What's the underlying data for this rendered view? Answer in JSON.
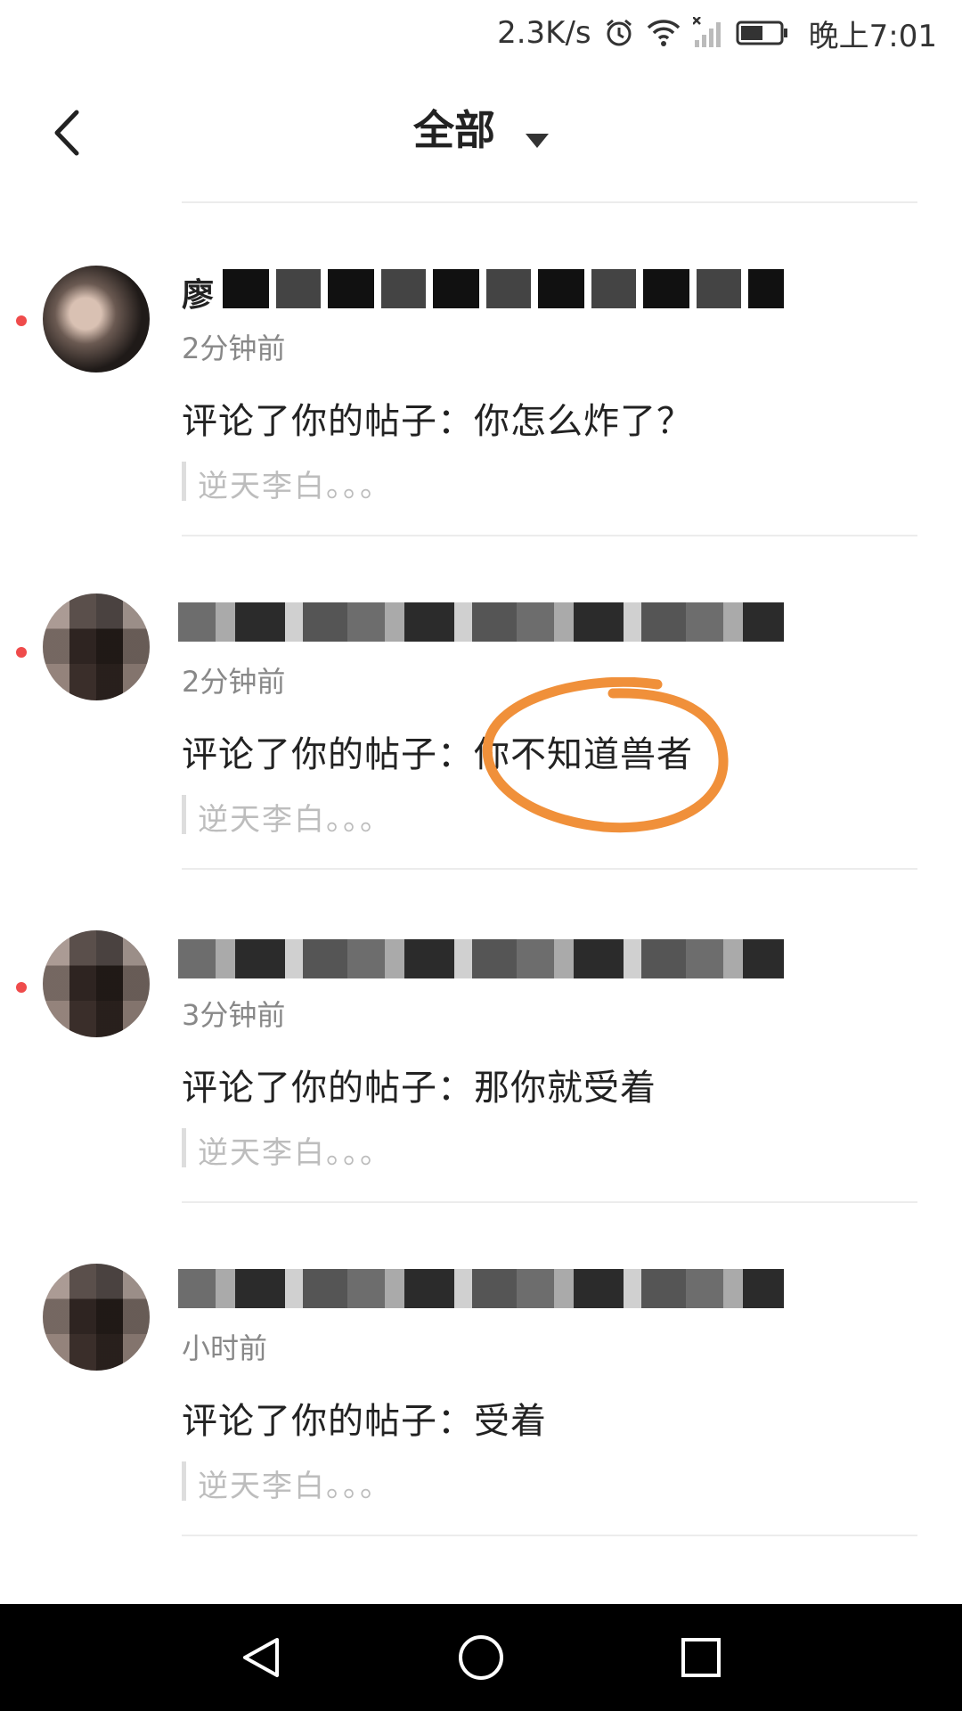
{
  "status_bar": {
    "net_speed": "2.3K/s",
    "time": "晚上7:01",
    "icons": [
      "alarm-icon",
      "wifi-icon",
      "signal-icon",
      "battery-icon"
    ]
  },
  "header": {
    "title": "全部",
    "back_icon": "chevron-left-icon",
    "filter_icon": "caret-down-icon"
  },
  "notifications": [
    {
      "name_visible": "廖",
      "time": "2分钟前",
      "comment": "评论了你的帖子：你怎么炸了？",
      "quote": "逆天李白。。。",
      "unread": true
    },
    {
      "name_visible": "",
      "time": "2分钟前",
      "comment": "评论了你的帖子：你不知道兽者",
      "quote": "逆天李白。。。",
      "unread": true
    },
    {
      "name_visible": "",
      "time": "3分钟前",
      "comment": "评论了你的帖子：那你就受着",
      "quote": "逆天李白。。。",
      "unread": true
    },
    {
      "name_visible": "",
      "time": "小时前",
      "comment": "评论了你的帖子：受着",
      "quote": "逆天李白。。。",
      "unread": false
    }
  ],
  "colors": {
    "unread_dot": "#ef4b4b",
    "highlight": "#f0903a",
    "system_nav": "#000000"
  },
  "system_nav": [
    "back-triangle-icon",
    "home-circle-icon",
    "recents-square-icon"
  ]
}
